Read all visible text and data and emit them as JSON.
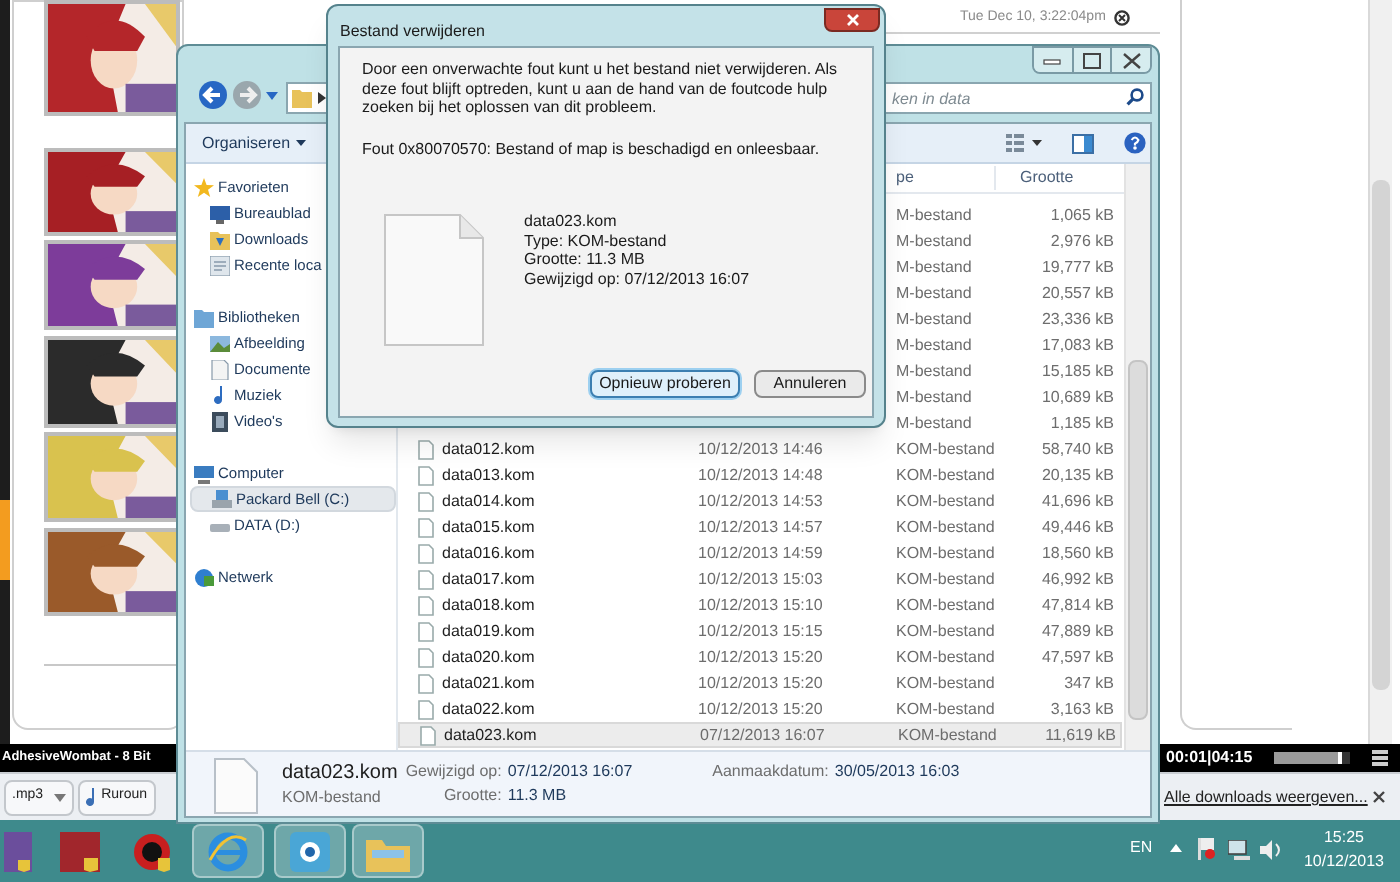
{
  "browser": {
    "clock": "Tue Dec 10, 3:22:04pm"
  },
  "explorer": {
    "search": {
      "placeholder": "ken in data"
    },
    "toolbar": {
      "organize": "Organiseren"
    },
    "columns": [
      {
        "label": "pe"
      },
      {
        "label": "Grootte"
      }
    ],
    "navigation": [
      {
        "label": "Favorieten",
        "kind": "star",
        "selected": false,
        "children": [
          {
            "label": "Bureaublad",
            "kind": "desktop",
            "selected": false
          },
          {
            "label": "Downloads",
            "kind": "download",
            "selected": false
          },
          {
            "label": "Recente loca",
            "kind": "recent",
            "selected": false
          }
        ]
      },
      {
        "label": "Bibliotheken",
        "kind": "library",
        "selected": false,
        "children": [
          {
            "label": "Afbeelding",
            "kind": "picture",
            "selected": false
          },
          {
            "label": "Documente",
            "kind": "document",
            "selected": false
          },
          {
            "label": "Muziek",
            "kind": "music",
            "selected": false
          },
          {
            "label": "Video's",
            "kind": "video",
            "selected": false
          }
        ]
      },
      {
        "label": "Computer",
        "kind": "computer",
        "selected": false,
        "children": [
          {
            "label": "Packard Bell (C:)",
            "kind": "systemdrive",
            "selected": true
          },
          {
            "label": "DATA (D:)",
            "kind": "drive",
            "selected": false
          }
        ]
      },
      {
        "label": "Netwerk",
        "kind": "network",
        "selected": false
      }
    ],
    "files": [
      {
        "type": "M-bestand",
        "size": "1,065 kB",
        "selected": false
      },
      {
        "type": "M-bestand",
        "size": "2,976 kB",
        "selected": false
      },
      {
        "type": "M-bestand",
        "size": "19,777 kB",
        "selected": false
      },
      {
        "type": "M-bestand",
        "size": "20,557 kB",
        "selected": false
      },
      {
        "type": "M-bestand",
        "size": "23,336 kB",
        "selected": false
      },
      {
        "type": "M-bestand",
        "size": "17,083 kB",
        "selected": false
      },
      {
        "type": "M-bestand",
        "size": "15,185 kB",
        "selected": false
      },
      {
        "type": "M-bestand",
        "size": "10,689 kB",
        "selected": false
      },
      {
        "type": "M-bestand",
        "size": "1,185 kB",
        "selected": false
      },
      {
        "name": "data012.kom",
        "date": "10/12/2013 14:46",
        "type": "KOM-bestand",
        "size": "58,740 kB",
        "selected": false
      },
      {
        "name": "data013.kom",
        "date": "10/12/2013 14:48",
        "type": "KOM-bestand",
        "size": "20,135 kB",
        "selected": false
      },
      {
        "name": "data014.kom",
        "date": "10/12/2013 14:53",
        "type": "KOM-bestand",
        "size": "41,696 kB",
        "selected": false
      },
      {
        "name": "data015.kom",
        "date": "10/12/2013 14:57",
        "type": "KOM-bestand",
        "size": "49,446 kB",
        "selected": false
      },
      {
        "name": "data016.kom",
        "date": "10/12/2013 14:59",
        "type": "KOM-bestand",
        "size": "18,560 kB",
        "selected": false
      },
      {
        "name": "data017.kom",
        "date": "10/12/2013 15:03",
        "type": "KOM-bestand",
        "size": "46,992 kB",
        "selected": false
      },
      {
        "name": "data018.kom",
        "date": "10/12/2013 15:10",
        "type": "KOM-bestand",
        "size": "47,814 kB",
        "selected": false
      },
      {
        "name": "data019.kom",
        "date": "10/12/2013 15:15",
        "type": "KOM-bestand",
        "size": "47,889 kB",
        "selected": false
      },
      {
        "name": "data020.kom",
        "date": "10/12/2013 15:20",
        "type": "KOM-bestand",
        "size": "47,597 kB",
        "selected": false
      },
      {
        "name": "data021.kom",
        "date": "10/12/2013 15:20",
        "type": "KOM-bestand",
        "size": "347 kB",
        "selected": false
      },
      {
        "name": "data022.kom",
        "date": "10/12/2013 15:20",
        "type": "KOM-bestand",
        "size": "3,163 kB",
        "selected": false
      },
      {
        "name": "data023.kom",
        "date": "07/12/2013 16:07",
        "type": "KOM-bestand",
        "size": "11,619 kB",
        "selected": true
      }
    ],
    "details": {
      "name": "data023.kom",
      "type": "KOM-bestand",
      "fields": [
        {
          "label": "Gewijzigd op:",
          "value": "07/12/2013 16:07"
        },
        {
          "label": "Grootte:",
          "value": "11.3 MB"
        },
        {
          "label": "Aanmaakdatum:",
          "value": "30/05/2013 16:03"
        }
      ]
    }
  },
  "dialog": {
    "title": "Bestand verwijderen",
    "message": "Door een onverwachte fout kunt u het bestand niet verwijderen. Als deze fout blijft optreden, kunt u aan de hand van de foutcode hulp zoeken bij het oplossen van dit probleem.",
    "error": "Fout 0x80070570: Bestand of map is beschadigd en onleesbaar.",
    "file": [
      "data023.kom",
      "Type: KOM-bestand",
      "Grootte: 11.3 MB",
      "Gewijzigd op: 07/12/2013 16:07"
    ],
    "buttons": [
      {
        "label": "Opnieuw proberen",
        "selected": true
      },
      {
        "label": "Annuleren",
        "selected": false
      }
    ]
  },
  "media_bar": {
    "track": "AdhesiveWombat - 8 Bit",
    "time": "00:01|04:15",
    "level": 0.9
  },
  "downloads_bar": {
    "items": [
      {
        "label": ".mp3",
        "kind": "dropdown"
      },
      {
        "label": "Ruroun",
        "kind": "music"
      }
    ],
    "show_all": "Alle downloads weergeven..."
  },
  "taskbar": {
    "language": "EN",
    "time": "15:25",
    "date": "10/12/2013"
  }
}
